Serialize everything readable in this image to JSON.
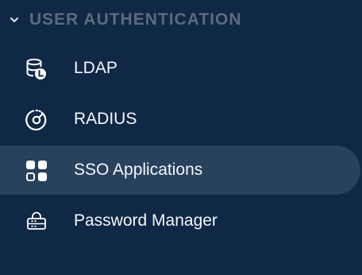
{
  "section": {
    "title": "USER AUTHENTICATION",
    "expanded": true,
    "chevron_icon": "chevron-down-icon"
  },
  "items": [
    {
      "label": "LDAP",
      "icon": "ldap-database-icon",
      "active": false
    },
    {
      "label": "RADIUS",
      "icon": "radius-icon",
      "active": false
    },
    {
      "label": "SSO Applications",
      "icon": "grid-apps-icon",
      "active": true
    },
    {
      "label": "Password Manager",
      "icon": "password-manager-icon",
      "active": false
    }
  ],
  "colors": {
    "background": "#0f2845",
    "active_background": "#28415c",
    "section_title": "#5b6b7e",
    "text": "#f4f7fb"
  }
}
